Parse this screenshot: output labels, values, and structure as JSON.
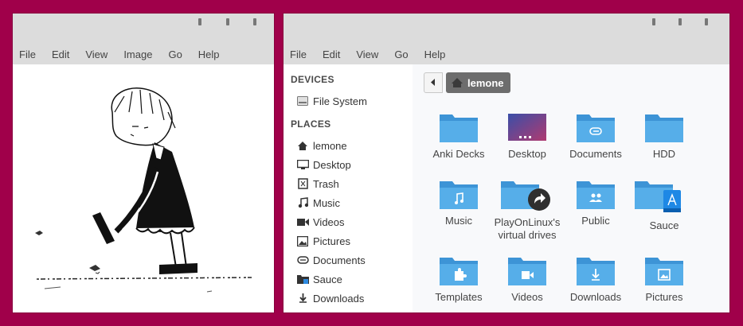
{
  "viewer": {
    "menu": [
      "File",
      "Edit",
      "View",
      "Image",
      "Go",
      "Help"
    ]
  },
  "files": {
    "menu": [
      "File",
      "Edit",
      "View",
      "Go",
      "Help"
    ],
    "sidebar": {
      "devices_header": "DEVICES",
      "devices": [
        {
          "label": "File System",
          "icon": "drive-icon"
        }
      ],
      "places_header": "PLACES",
      "places": [
        {
          "label": "lemone",
          "icon": "home-icon"
        },
        {
          "label": "Desktop",
          "icon": "monitor-icon"
        },
        {
          "label": "Trash",
          "icon": "trash-icon"
        },
        {
          "label": "Music",
          "icon": "music-note-icon"
        },
        {
          "label": "Videos",
          "icon": "video-camera-icon"
        },
        {
          "label": "Pictures",
          "icon": "picture-icon"
        },
        {
          "label": "Documents",
          "icon": "paperclip-icon"
        },
        {
          "label": "Sauce",
          "icon": "folder-app-icon"
        },
        {
          "label": "Downloads",
          "icon": "download-icon"
        }
      ]
    },
    "breadcrumb": {
      "current": "lemone"
    },
    "items": [
      {
        "label": "Anki Decks",
        "icon": "folder-icon"
      },
      {
        "label": "Desktop",
        "icon": "desktop-folder-icon"
      },
      {
        "label": "Documents",
        "icon": "folder-documents-icon"
      },
      {
        "label": "HDD",
        "icon": "folder-icon"
      },
      {
        "label": "Music",
        "icon": "folder-music-icon"
      },
      {
        "label": "PlayOnLinux's virtual drives",
        "icon": "folder-link-icon"
      },
      {
        "label": "Public",
        "icon": "folder-public-icon"
      },
      {
        "label": "Sauce",
        "icon": "folder-app-icon"
      },
      {
        "label": "Templates",
        "icon": "folder-templates-icon"
      },
      {
        "label": "Videos",
        "icon": "folder-videos-icon"
      },
      {
        "label": "Downloads",
        "icon": "folder-downloads-icon"
      },
      {
        "label": "Pictures",
        "icon": "folder-pictures-icon"
      }
    ]
  },
  "colors": {
    "desktop_bg": "#a0004a",
    "folder_blue": "#4aa6e6",
    "breadcrumb_bg": "#6d6d6d"
  }
}
